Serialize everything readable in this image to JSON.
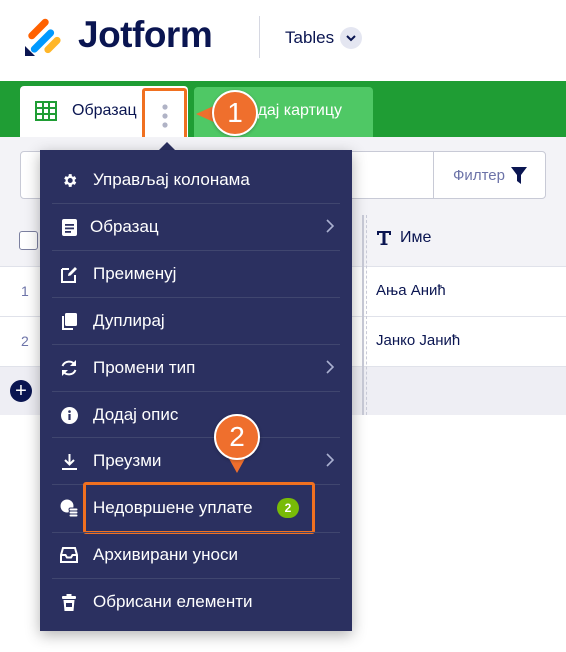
{
  "header": {
    "logo_text": "Jotform",
    "product_label": "Tables",
    "brand_colors": [
      "#ff6100",
      "#0099ff",
      "#ffb629",
      "#0a1551"
    ]
  },
  "tabs": {
    "active_label": "Образац",
    "add_label": "Додај картицу",
    "bar_color": "#1f9d34"
  },
  "callouts": {
    "first": "1",
    "second": "2",
    "color": "#ef6f2d"
  },
  "toolbar": {
    "filter_label": "Филтер"
  },
  "table": {
    "column_name": "Име",
    "rows": [
      {
        "number": "1",
        "name": "Ања Анић"
      },
      {
        "number": "2",
        "name": "Јанко Јанић"
      }
    ]
  },
  "menu": {
    "background": "#2b3060",
    "items": [
      {
        "label": "Управљај колонама",
        "icon": "gear-icon"
      },
      {
        "label": "Образац",
        "icon": "form-icon",
        "submenu": true
      },
      {
        "label": "Преименуј",
        "icon": "edit-icon"
      },
      {
        "label": "Дуплирај",
        "icon": "duplicate-icon"
      },
      {
        "label": "Промени тип",
        "icon": "refresh-icon",
        "submenu": true
      },
      {
        "label": "Додај опис",
        "icon": "info-icon"
      },
      {
        "label": "Преузми",
        "icon": "download-icon",
        "submenu": true
      },
      {
        "label": "Недовршене уплате",
        "icon": "coins-icon",
        "badge": "2"
      },
      {
        "label": "Архивирани уноси",
        "icon": "inbox-icon"
      },
      {
        "label": "Обрисани елементи",
        "icon": "trash-icon"
      }
    ]
  }
}
